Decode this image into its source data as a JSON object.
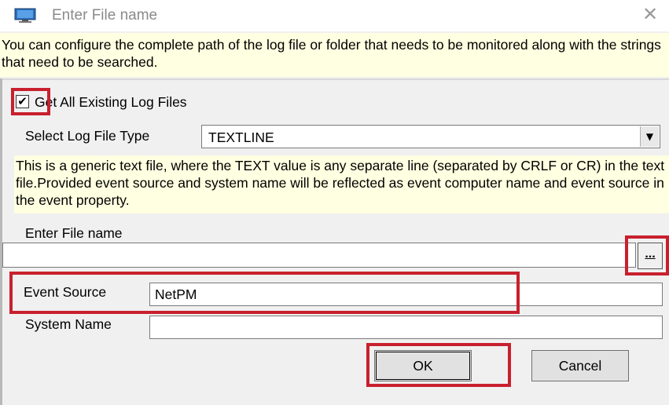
{
  "window": {
    "title": "Enter File name",
    "app_icon": "monitor-icon",
    "close_icon": "close-icon"
  },
  "info": {
    "top_text": "You can configure the complete path of the log file or folder that needs to be monitored along with the strings that need to be searched.",
    "type_description": "This is a generic text file, where the TEXT value is any separate line (separated by CRLF or CR) in the text file.Provided event source and system name will be reflected as event computer name and event source in the event property."
  },
  "checkbox": {
    "label": "Get All Existing Log Files",
    "checked": true,
    "mark": "✔"
  },
  "log_type": {
    "label": "Select Log File Type",
    "value": "TEXTLINE",
    "arrow": "▼"
  },
  "file": {
    "label": "Enter File name",
    "value": "",
    "browse_label": "..."
  },
  "event_source": {
    "label": "Event Source",
    "value": "NetPM"
  },
  "system_name": {
    "label": "System Name",
    "value": ""
  },
  "buttons": {
    "ok": "OK",
    "cancel": "Cancel"
  },
  "colors": {
    "highlight": "#c8202e",
    "info_background": "#ffffe1",
    "dialog_background": "#f0f0f0"
  }
}
